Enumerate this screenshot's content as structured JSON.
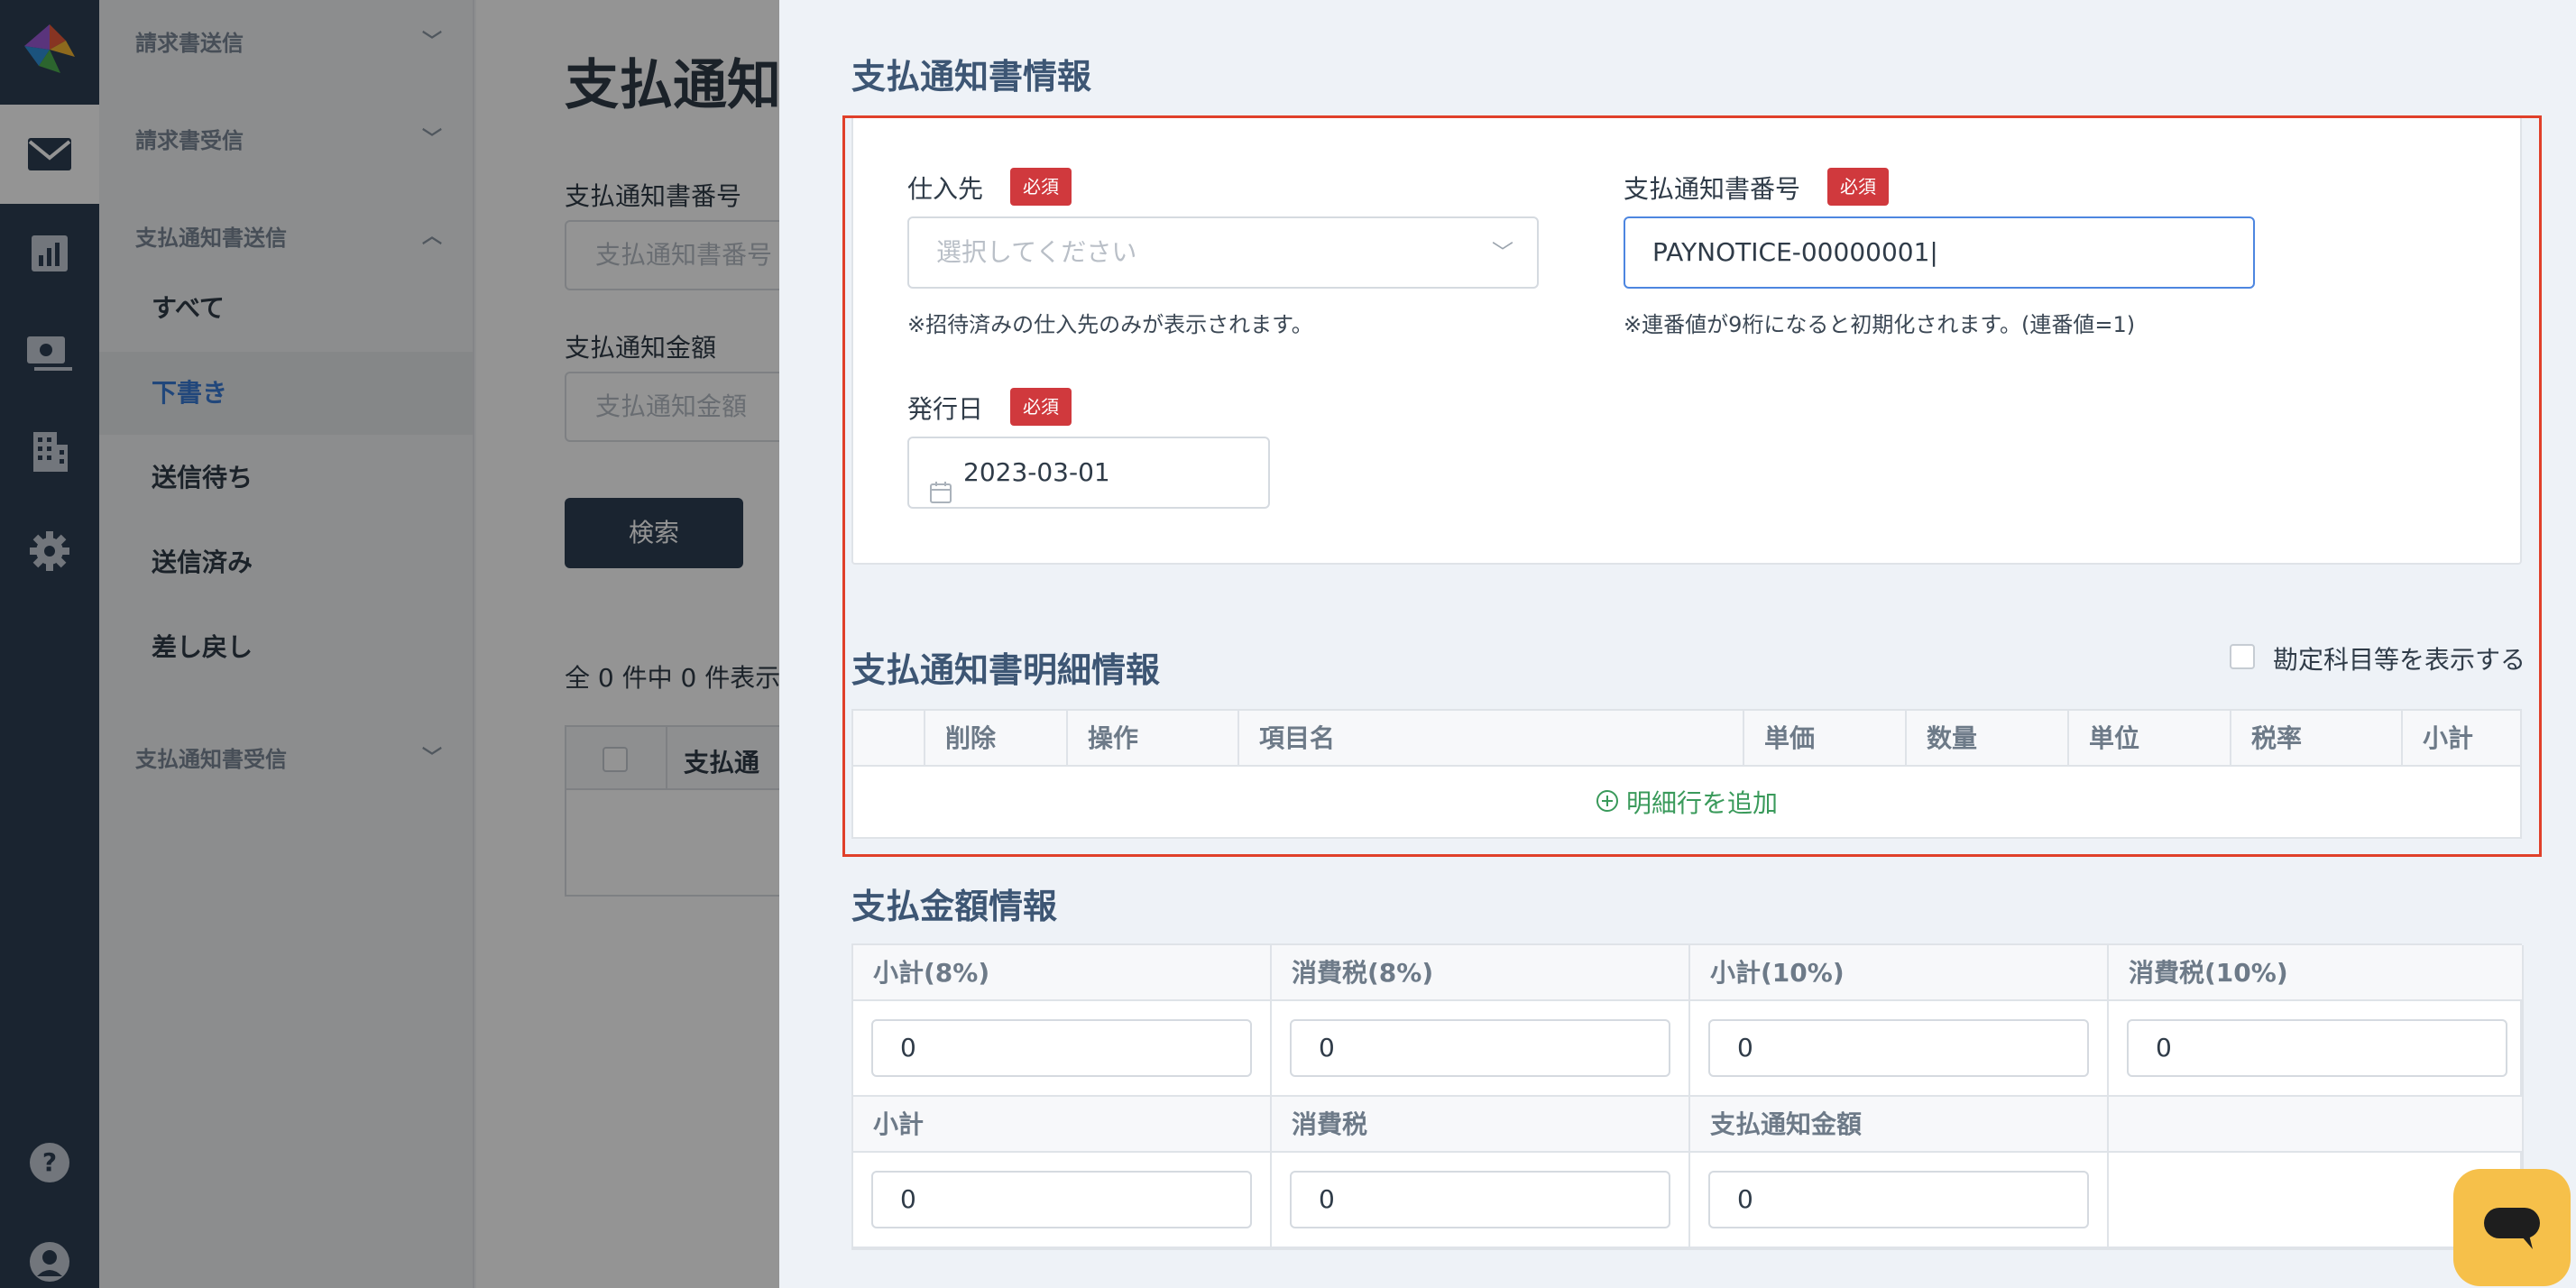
{
  "nav": {
    "groups": {
      "invoice_send": "請求書送信",
      "invoice_receive": "請求書受信",
      "payment_send": "支払通知書送信",
      "payment_receive": "支払通知書受信"
    },
    "sub_items": [
      "すべて",
      "下書き",
      "送信待ち",
      "送信済み",
      "差し戻し"
    ],
    "active_sub": "下書き"
  },
  "background": {
    "title": "支払通知",
    "number_label": "支払通知書番号",
    "number_placeholder": "支払通知書番号",
    "amount_label": "支払通知金額",
    "amount_placeholder": "支払通知金額",
    "search_button": "検索",
    "count_text": "全 0 件中 0 件表示し",
    "table_header": "支払通"
  },
  "panel": {
    "info_title": "支払通知書情報",
    "required_badge": "必須",
    "supplier": {
      "label": "仕入先",
      "placeholder": "選択してください",
      "hint": "※招待済みの仕入先のみが表示されます。"
    },
    "notice_number": {
      "label": "支払通知書番号",
      "value": "PAYNOTICE-00000001",
      "hint": "※連番値が9桁になると初期化されます。(連番値=1)"
    },
    "issue_date": {
      "label": "発行日",
      "value": "2023-03-01"
    },
    "detail_title": "支払通知書明細情報",
    "show_accounts_label": "勘定科目等を表示する",
    "detail_columns": [
      "削除",
      "操作",
      "項目名",
      "単価",
      "数量",
      "単位",
      "税率",
      "小計"
    ],
    "add_row_label": "明細行を追加",
    "amount_title": "支払金額情報",
    "amount_row1": [
      {
        "label": "小計(8%)",
        "value": "0"
      },
      {
        "label": "消費税(8%)",
        "value": "0"
      },
      {
        "label": "小計(10%)",
        "value": "0"
      },
      {
        "label": "消費税(10%)",
        "value": "0"
      }
    ],
    "amount_row2": [
      {
        "label": "小計",
        "value": "0"
      },
      {
        "label": "消費税",
        "value": "0"
      },
      {
        "label": "支払通知金額",
        "value": "0"
      }
    ]
  },
  "colors": {
    "rail": "#2e3e53",
    "accent": "#3a7bd5",
    "required": "#d0393d",
    "section_title": "#3d5674",
    "add_row": "#3a9a5b",
    "highlight": "#e0402a",
    "chat": "#f6c04a"
  },
  "icons": {
    "logo": "logo-icon",
    "mail": "mail-icon",
    "chart": "chart-icon",
    "payment": "payment-icon",
    "building": "building-icon",
    "gear": "gear-icon",
    "help": "help-icon",
    "user": "user-icon",
    "chat": "chat-icon"
  }
}
